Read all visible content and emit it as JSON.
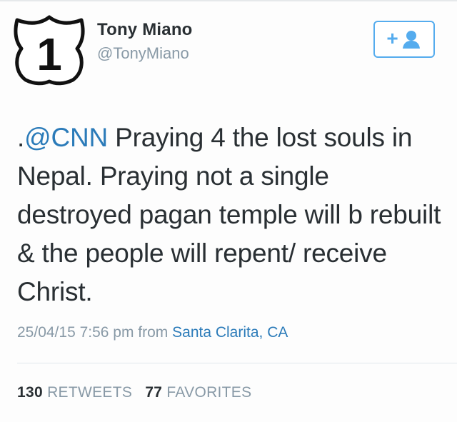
{
  "colors": {
    "link": "#2b7bb9",
    "follow_accent": "#55acee",
    "muted": "#8899a6",
    "text": "#292f33"
  },
  "profile": {
    "display_name": "Tony Miano",
    "handle": "@TonyMiano",
    "avatar_icon": "route-shield-icon",
    "avatar_number": "1"
  },
  "follow_button": {
    "plus": "+",
    "icon": "person-icon"
  },
  "tweet": {
    "prefix": ".",
    "mention": "@CNN",
    "body": " Praying 4 the lost souls in Nepal. Praying not a single destroyed pagan temple will b rebuilt & the people will repent/ receive Christ."
  },
  "meta": {
    "timestamp": "25/04/15 7:56 pm from",
    "location": "Santa Clarita, CA"
  },
  "stats": {
    "retweets_count": "130",
    "retweets_label": "RETWEETS",
    "favorites_count": "77",
    "favorites_label": "FAVORITES"
  }
}
